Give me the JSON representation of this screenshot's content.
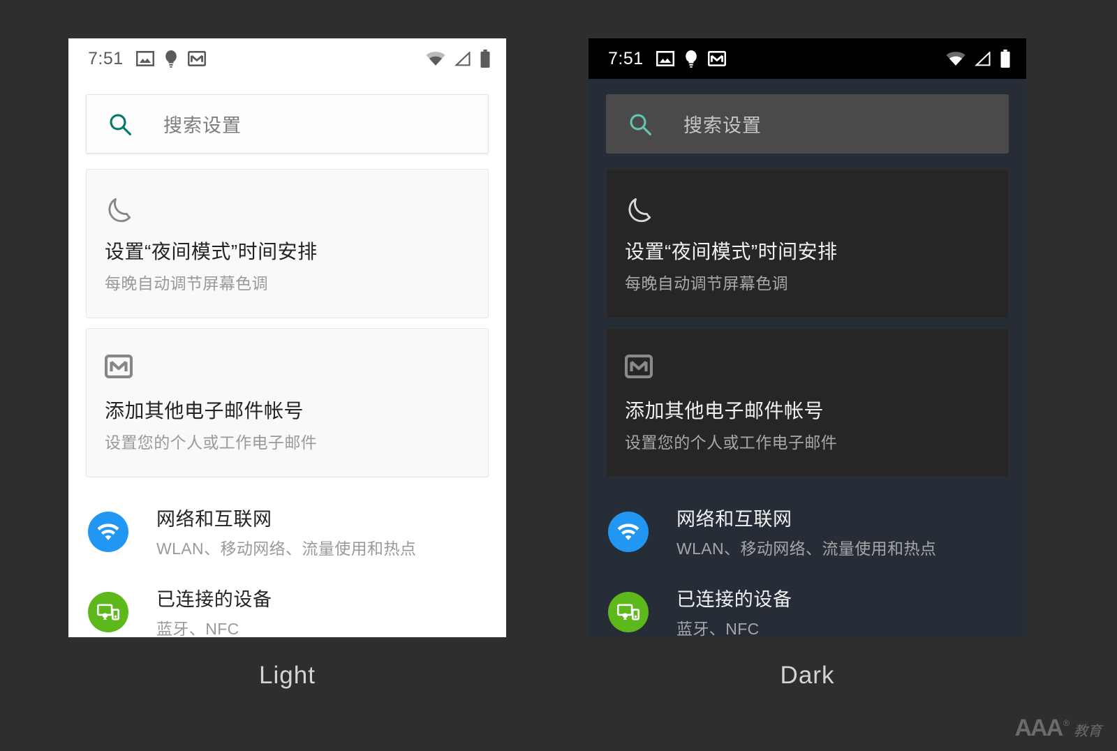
{
  "page": {
    "background_color": "#2e2e2e",
    "captions": {
      "light": "Light",
      "dark": "Dark"
    },
    "watermark": {
      "mark": "AAA",
      "registered": "®",
      "chinese": "教育"
    }
  },
  "status_bar": {
    "time": "7:51",
    "left_icons": [
      "image-icon",
      "lightbulb-icon",
      "gmail-icon"
    ],
    "right_icons": [
      "wifi-icon",
      "cell-signal-icon",
      "battery-icon"
    ]
  },
  "search": {
    "icon": "search-icon",
    "placeholder": "搜索设置",
    "icon_color_light": "#00796b",
    "icon_color_dark": "#67c4b2"
  },
  "suggestion_cards": [
    {
      "icon": "moon-icon",
      "title": "设置“夜间模式”时间安排",
      "subtitle": "每晚自动调节屏幕色调"
    },
    {
      "icon": "gmail-icon",
      "title": "添加其他电子邮件帐号",
      "subtitle": "设置您的个人或工作电子邮件"
    }
  ],
  "settings_items": [
    {
      "icon": "wifi-circle-icon",
      "badge_color": "#2196f3",
      "title": "网络和互联网",
      "subtitle": "WLAN、移动网络、流量使用和热点"
    },
    {
      "icon": "connected-devices-icon",
      "badge_color": "#5cb81b",
      "title": "已连接的设备",
      "subtitle": "蓝牙、NFC"
    }
  ],
  "themes": {
    "light": {
      "screen_background": "#ffffff",
      "card_background": "#f9f9f9",
      "search_background": "#fdfdfd",
      "status_bar_background": "#ffffff",
      "primary_text": "#232323",
      "secondary_text": "#9a9a9a"
    },
    "dark": {
      "screen_background": "#262d36",
      "card_background": "#262626",
      "search_background": "#4a4a4a",
      "status_bar_background": "#000000",
      "primary_text": "#f1f1f1",
      "secondary_text": "#a6a6a6"
    }
  }
}
